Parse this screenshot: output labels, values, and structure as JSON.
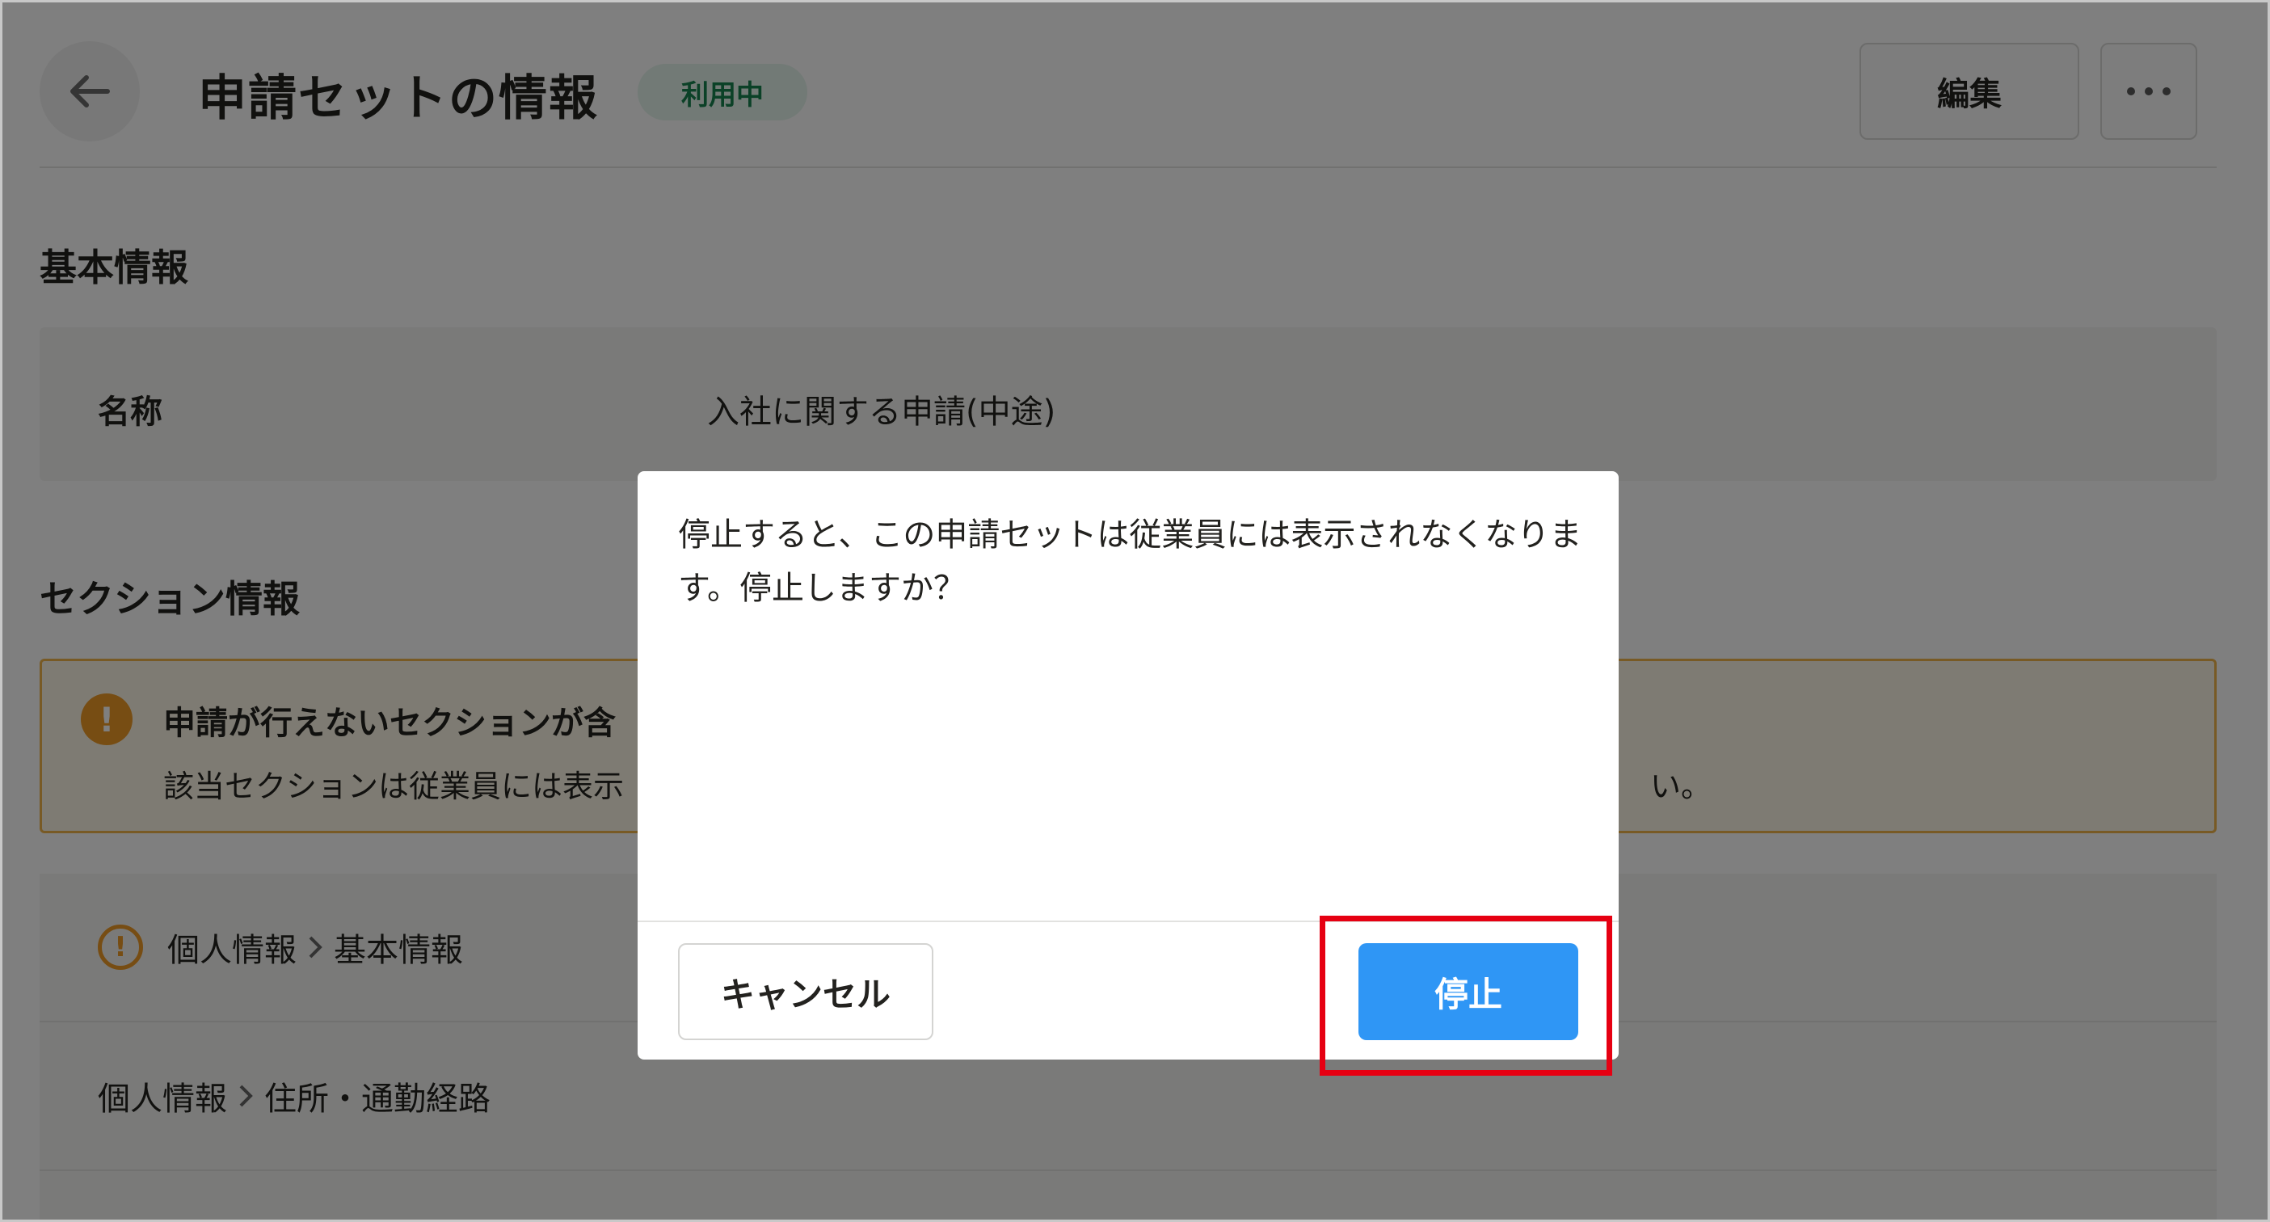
{
  "header": {
    "title": "申請セットの情報",
    "status": "利用中",
    "edit_label": "編集"
  },
  "basic_info": {
    "heading": "基本情報",
    "name_label": "名称",
    "name_value": "入社に関する申請(中途)"
  },
  "section_info": {
    "heading": "セクション情報",
    "warning_title": "申請が行えないセクションが含",
    "warning_text": "該当セクションは従業員には表示",
    "warning_text_tail": "い。",
    "items": [
      {
        "parent": "個人情報",
        "child": "基本情報",
        "warning": true
      },
      {
        "parent": "個人情報",
        "child": "住所・通勤経路",
        "warning": false
      }
    ]
  },
  "modal": {
    "message": "停止すると、この申請セットは従業員には表示されなくなります。停止しますか？",
    "cancel_label": "キャンセル",
    "stop_label": "停止"
  },
  "colors": {
    "status_badge": "#e5f4ec",
    "warning": "#ee9a26",
    "primary_button": "#2f96f5",
    "highlight": "#e60012"
  },
  "icons": {
    "back": "arrow-left-icon",
    "more": "ellipsis-icon",
    "warning": "exclamation-circle-icon",
    "separator": "chevron-right-icon"
  }
}
